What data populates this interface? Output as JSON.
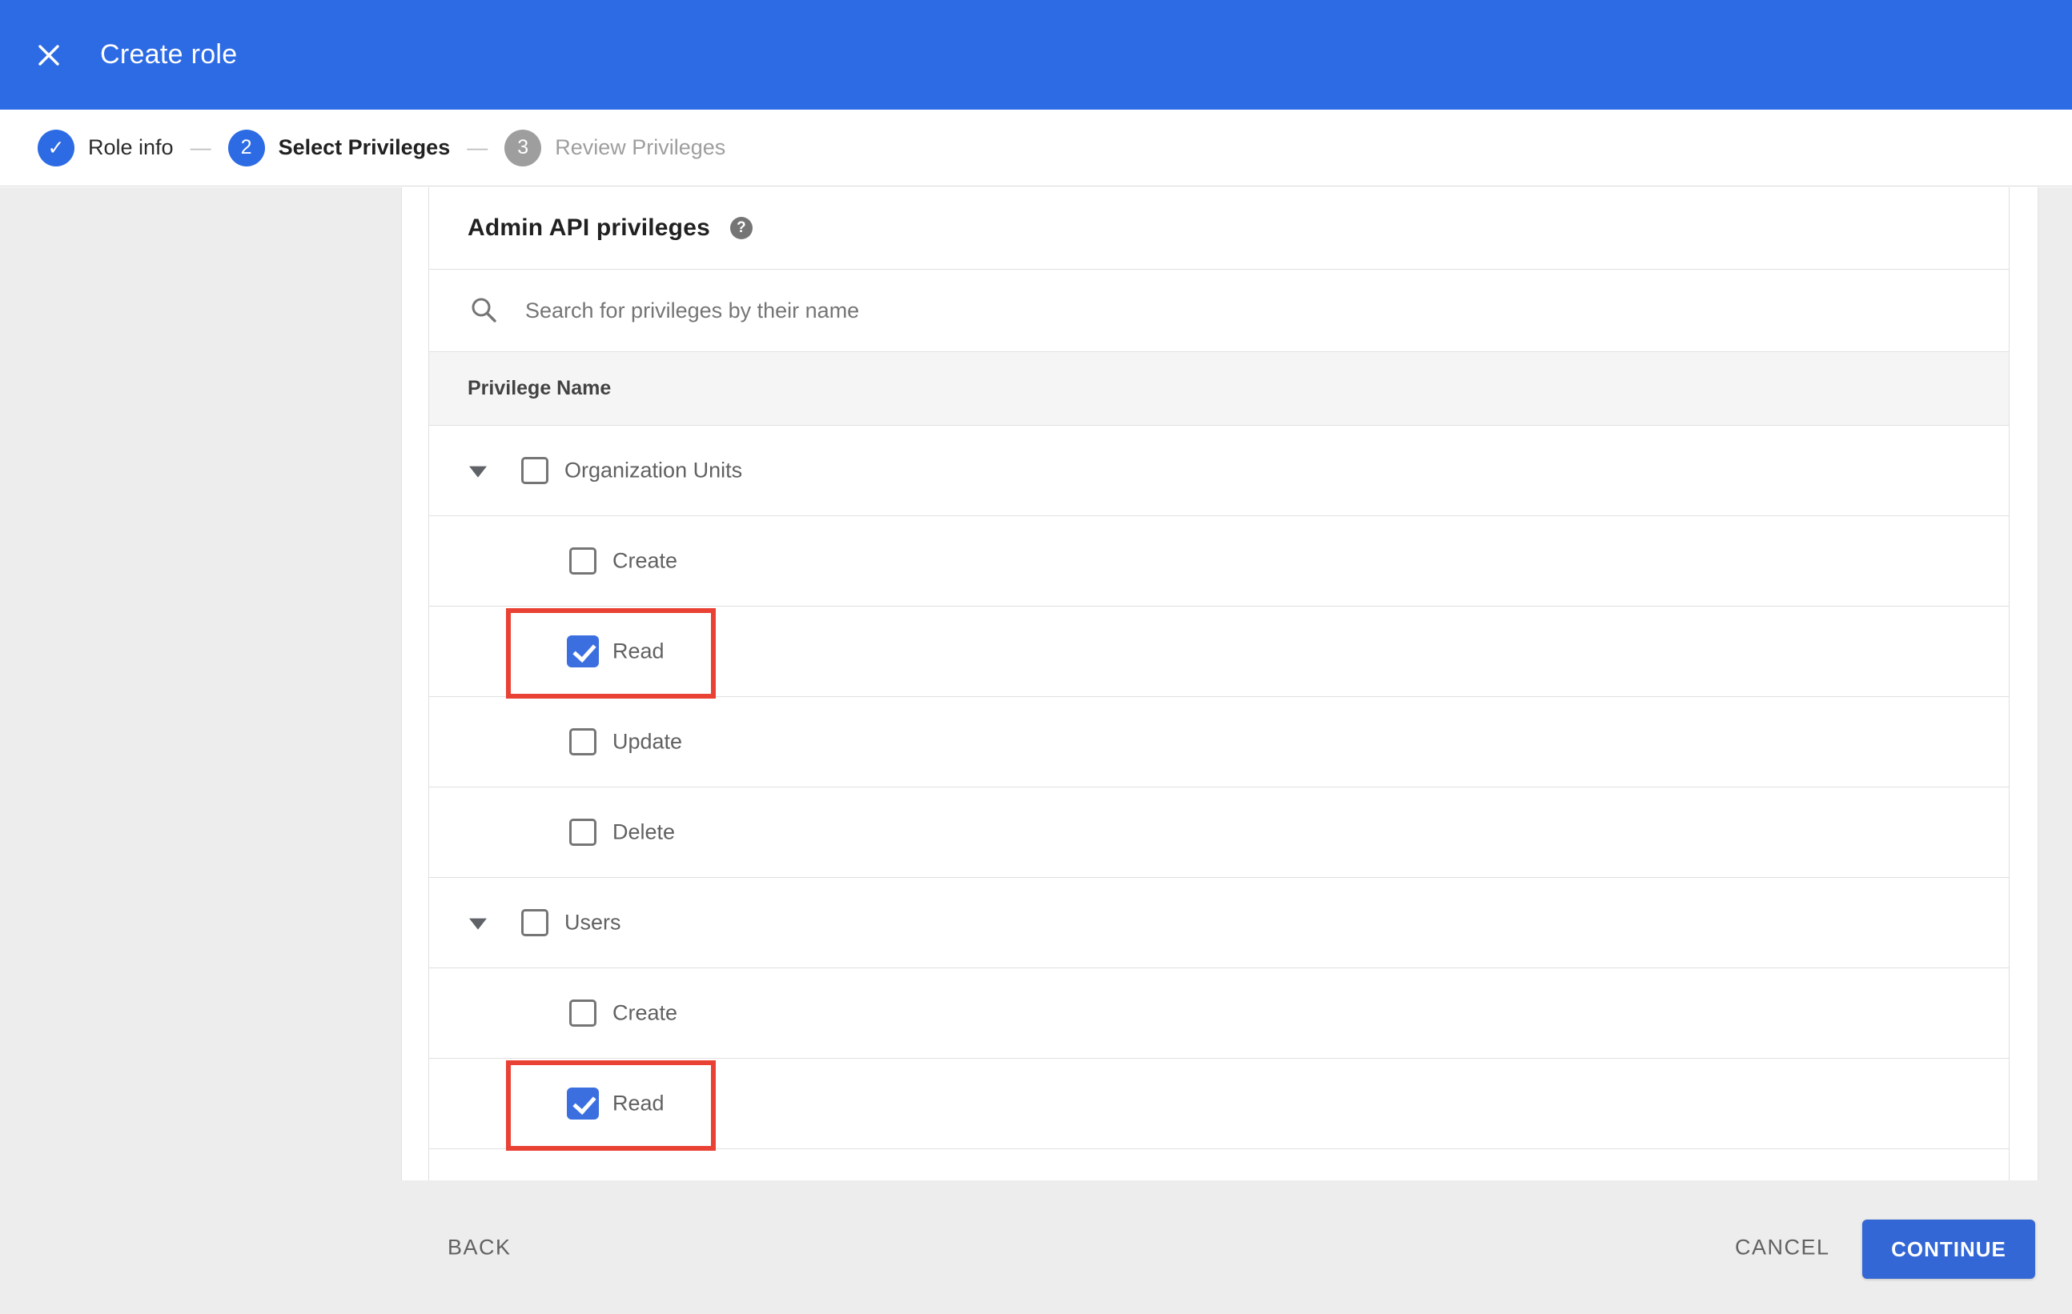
{
  "header": {
    "title": "Create role",
    "close_icon": "close-x"
  },
  "stepper": {
    "separator": "—",
    "steps": [
      {
        "marker": "✓",
        "label": "Role info",
        "state": "completed"
      },
      {
        "marker": "2",
        "label": "Select Privileges",
        "state": "active"
      },
      {
        "marker": "3",
        "label": "Review Privileges",
        "state": "upcoming"
      }
    ]
  },
  "panel": {
    "heading": "Admin API privileges",
    "help_icon": "?",
    "search": {
      "placeholder": "Search for privileges by their name",
      "value": ""
    },
    "column_header": "Privilege Name"
  },
  "privileges": {
    "groups": [
      {
        "label": "Organization Units",
        "checked": false,
        "expanded": true,
        "children": [
          {
            "label": "Create",
            "checked": false,
            "highlighted": false
          },
          {
            "label": "Read",
            "checked": true,
            "highlighted": true
          },
          {
            "label": "Update",
            "checked": false,
            "highlighted": false
          },
          {
            "label": "Delete",
            "checked": false,
            "highlighted": false
          }
        ]
      },
      {
        "label": "Users",
        "checked": false,
        "expanded": true,
        "children": [
          {
            "label": "Create",
            "checked": false,
            "highlighted": false
          },
          {
            "label": "Read",
            "checked": true,
            "highlighted": true
          }
        ]
      }
    ]
  },
  "footer": {
    "back_label": "BACK",
    "cancel_label": "CANCEL",
    "continue_label": "CONTINUE"
  },
  "colors": {
    "header_blue": "#2d6be4",
    "step_blue": "#2d6be4",
    "checkbox_blue": "#3b6fe0",
    "continue_blue": "#3367d6",
    "highlight_red": "#e94235",
    "page_gray": "#ededed",
    "table_header_gray": "#f5f5f5",
    "border_gray": "#e0e0e0"
  }
}
